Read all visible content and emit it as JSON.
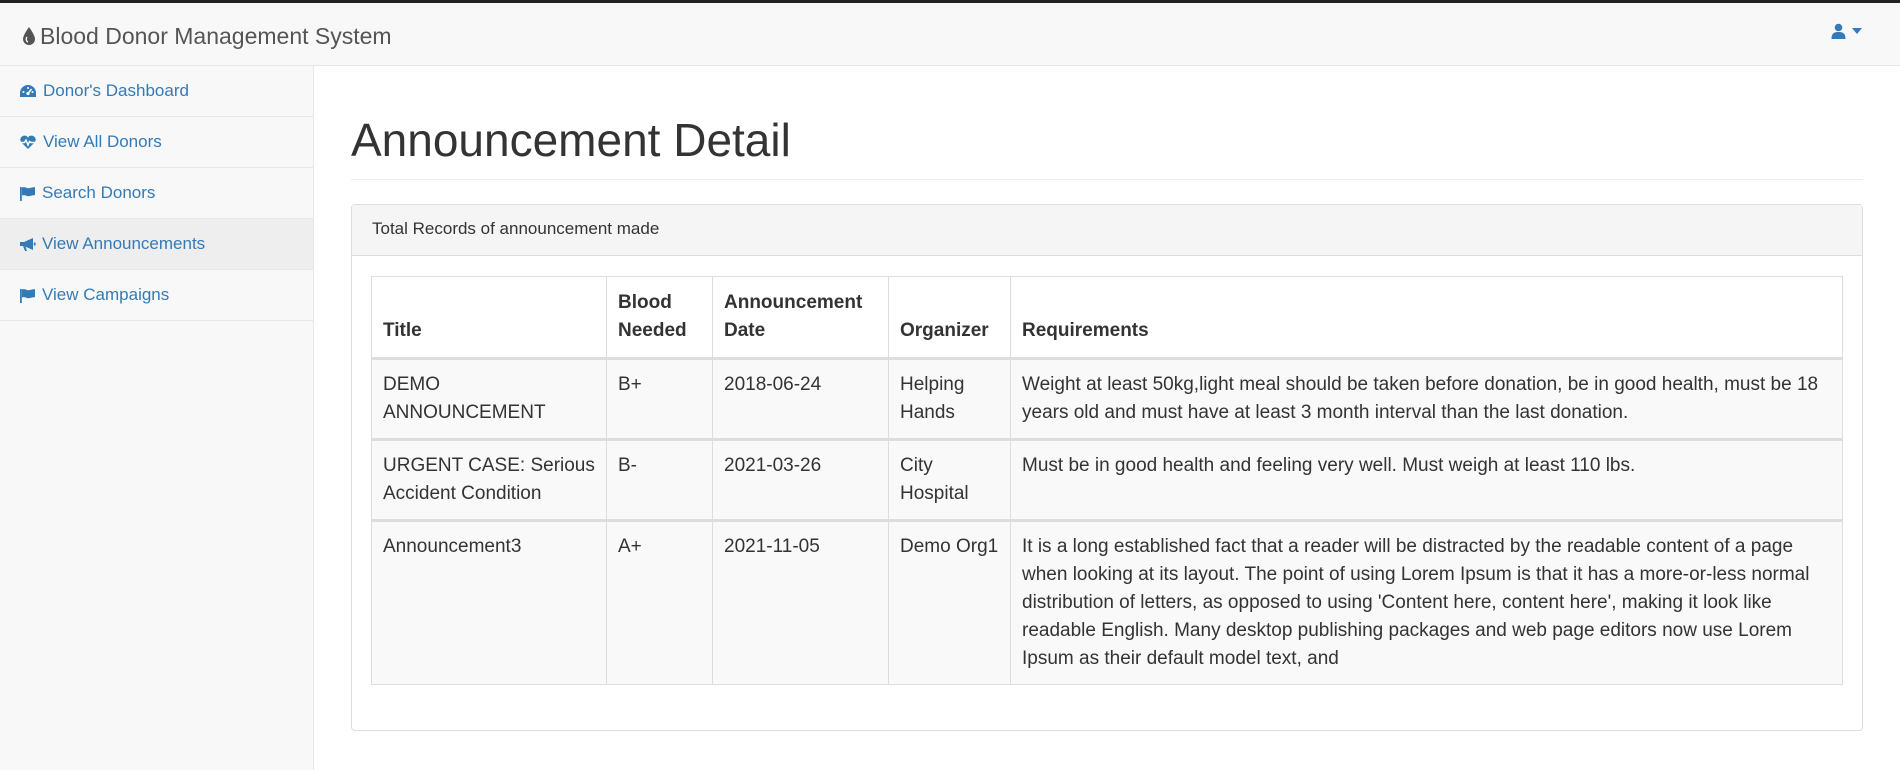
{
  "app": {
    "title": "Blood Donor Management System"
  },
  "user_menu": {
    "icon": "user-icon"
  },
  "sidebar": {
    "items": [
      {
        "label": "Donor's Dashboard",
        "icon": "dashboard-icon"
      },
      {
        "label": "View All Donors",
        "icon": "heartbeat-icon"
      },
      {
        "label": "Search Donors",
        "icon": "flag-icon"
      },
      {
        "label": "View Announcements",
        "icon": "bullhorn-icon",
        "active": true
      },
      {
        "label": "View Campaigns",
        "icon": "flag-icon"
      }
    ]
  },
  "main": {
    "title": "Announcement Detail",
    "panel_heading": "Total Records of announcement made",
    "table": {
      "headers": [
        "Title",
        "Blood Needed",
        "Announcement Date",
        "Organizer",
        "Requirements"
      ],
      "rows": [
        [
          "DEMO ANNOUNCEMENT",
          "B+",
          "2018-06-24",
          "Helping Hands",
          "Weight at least 50kg,light meal should be taken before donation, be in good health, must be 18 years old and must have at least 3 month interval than the last donation."
        ],
        [
          "URGENT CASE: Serious Accident Condition",
          "B-",
          "2021-03-26",
          "City Hospital",
          "Must be in good health and feeling very well. Must weigh at least 110 lbs."
        ],
        [
          "Announcement3",
          "A+",
          "2021-11-05",
          "Demo Org1",
          "It is a long established fact that a reader will be distracted by the readable content of a page when looking at its layout. The point of using Lorem Ipsum is that it has a more-or-less normal distribution of letters, as opposed to using 'Content here, content here', making it look like readable English. Many desktop publishing packages and web page editors now use Lorem Ipsum as their default model text, and"
        ]
      ]
    }
  },
  "colors": {
    "link": "#337ab7",
    "nav_bg": "#f8f8f8",
    "active_bg": "#eeeeee"
  }
}
